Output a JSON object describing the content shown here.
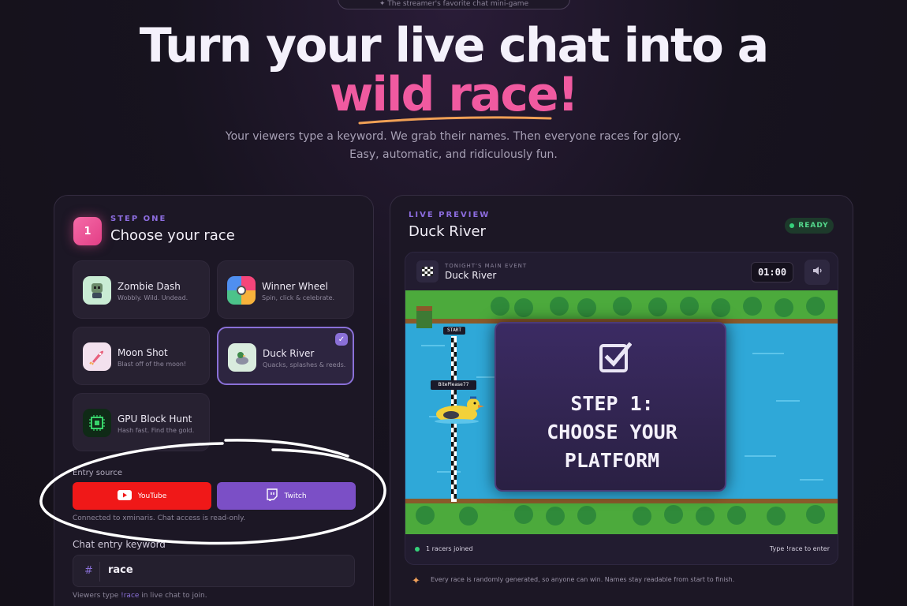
{
  "hero": {
    "pill_text": "✦ The streamer's favorite chat mini-game",
    "line1": "Turn your live chat into a",
    "line2": "wild race!",
    "sub1": "Your viewers type a keyword. We grab their names. Then everyone races for glory.",
    "sub2": "Easy, automatic, and ridiculously fun.",
    "accent_color": "#f05aa0"
  },
  "left": {
    "step_number": "1",
    "eyebrow": "STEP ONE",
    "title": "Choose your race",
    "races": [
      {
        "name": "Zombie Dash",
        "desc": "Wobbly. Wild. Undead.",
        "icon": "zombie-icon"
      },
      {
        "name": "Winner Wheel",
        "desc": "Spin, click & celebrate.",
        "icon": "wheel-icon"
      },
      {
        "name": "Moon Shot",
        "desc": "Blast off of the moon!",
        "icon": "rocket-icon"
      },
      {
        "name": "Duck River",
        "desc": "Quacks, splashes & reeds.",
        "icon": "duck-icon",
        "selected": true
      },
      {
        "name": "GPU Block Hunt",
        "desc": "Hash fast. Find the gold.",
        "icon": "chip-icon"
      }
    ],
    "entry_source_label": "Entry source",
    "youtube_label": "YouTube",
    "twitch_label": "Twitch",
    "connected_note": "Connected to xminaris. Chat access is read-only.",
    "keyword_label": "Chat entry keyword",
    "keyword_hash": "#",
    "keyword_value": "race",
    "join_note_prefix": "Viewers type ",
    "join_note_keyword": "!race",
    "join_note_suffix": " in live chat to join."
  },
  "right": {
    "eyebrow": "LIVE PREVIEW",
    "title": "Duck River",
    "status": "READY",
    "preview": {
      "eyebrow": "TONIGHT'S MAIN EVENT",
      "title": "Duck River",
      "timer": "01:00",
      "start_label": "START",
      "racer_name": "BitePlease77",
      "overlay_lines": [
        "STEP 1:",
        "CHOOSE YOUR",
        "PLATFORM"
      ],
      "racers_joined": "1 racers joined",
      "type_hint": "Type !race to enter"
    },
    "disclaimer": "Every race is randomly generated, so anyone can win. Names stay readable from start to finish."
  }
}
